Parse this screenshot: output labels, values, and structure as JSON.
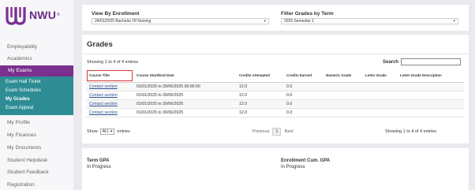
{
  "brand": {
    "name": "NWU",
    "reg": "®"
  },
  "sidebar": {
    "items_before": [
      "Employability",
      "Academics"
    ],
    "active": "My Exams",
    "submenu": [
      "Exam Hall Ticket",
      "Exam Schedules",
      "My Grades",
      "Exam Appeal"
    ],
    "items_after": [
      "My Profile",
      "My Finances",
      "My Documents",
      "Student Helpdesk",
      "Student Feedback",
      "Registration"
    ]
  },
  "filters": {
    "enrollment_label": "View By Enrollment",
    "enrollment_value": "24/01/2025 Bachelor Of Nursing",
    "term_label": "Filter Grades by Term",
    "term_value": "2025 Semester 1"
  },
  "grades": {
    "title": "Grades",
    "showing_top": "Showing 1 to 4 of 4 entries",
    "search_label": "Search",
    "columns": [
      "Course Title",
      "Course Start/End Date",
      "Credits Attempted",
      "Credits Earned",
      "Numeric Grade",
      "Letter Grade",
      "Letter Grade Description"
    ],
    "rows": [
      [
        "Contact section",
        "01/01/2025 to 30/06/2025 00:00:00",
        "12.0",
        "0.0",
        "",
        "",
        ""
      ],
      [
        "Contact section",
        "01/01/2025 to 30/06/2025",
        "12.0",
        "0.0",
        "",
        "",
        ""
      ],
      [
        "Contact section",
        "01/01/2025 to 30/06/2025",
        "12.0",
        "0.0",
        "",
        "",
        ""
      ],
      [
        "Contact section",
        "01/01/2025 to 30/06/2025",
        "12.0",
        "0.0",
        "",
        "",
        ""
      ]
    ],
    "show_label": "Show",
    "show_value": "ALL",
    "entries_label": "entries",
    "previous": "Previous",
    "page": "1",
    "next": "Next",
    "showing_bottom": "Showing 1 to 4 of 4 entries"
  },
  "gpa": {
    "term_label": "Term GPA",
    "term_value": "In Progress",
    "cum_label": "Enrollment Cum. GPA",
    "cum_value": "In Progress"
  },
  "colors": {
    "brand_purple": "#7b2f8f",
    "submenu_teal": "#2e8c95",
    "highlight_red": "#d23a3a"
  }
}
